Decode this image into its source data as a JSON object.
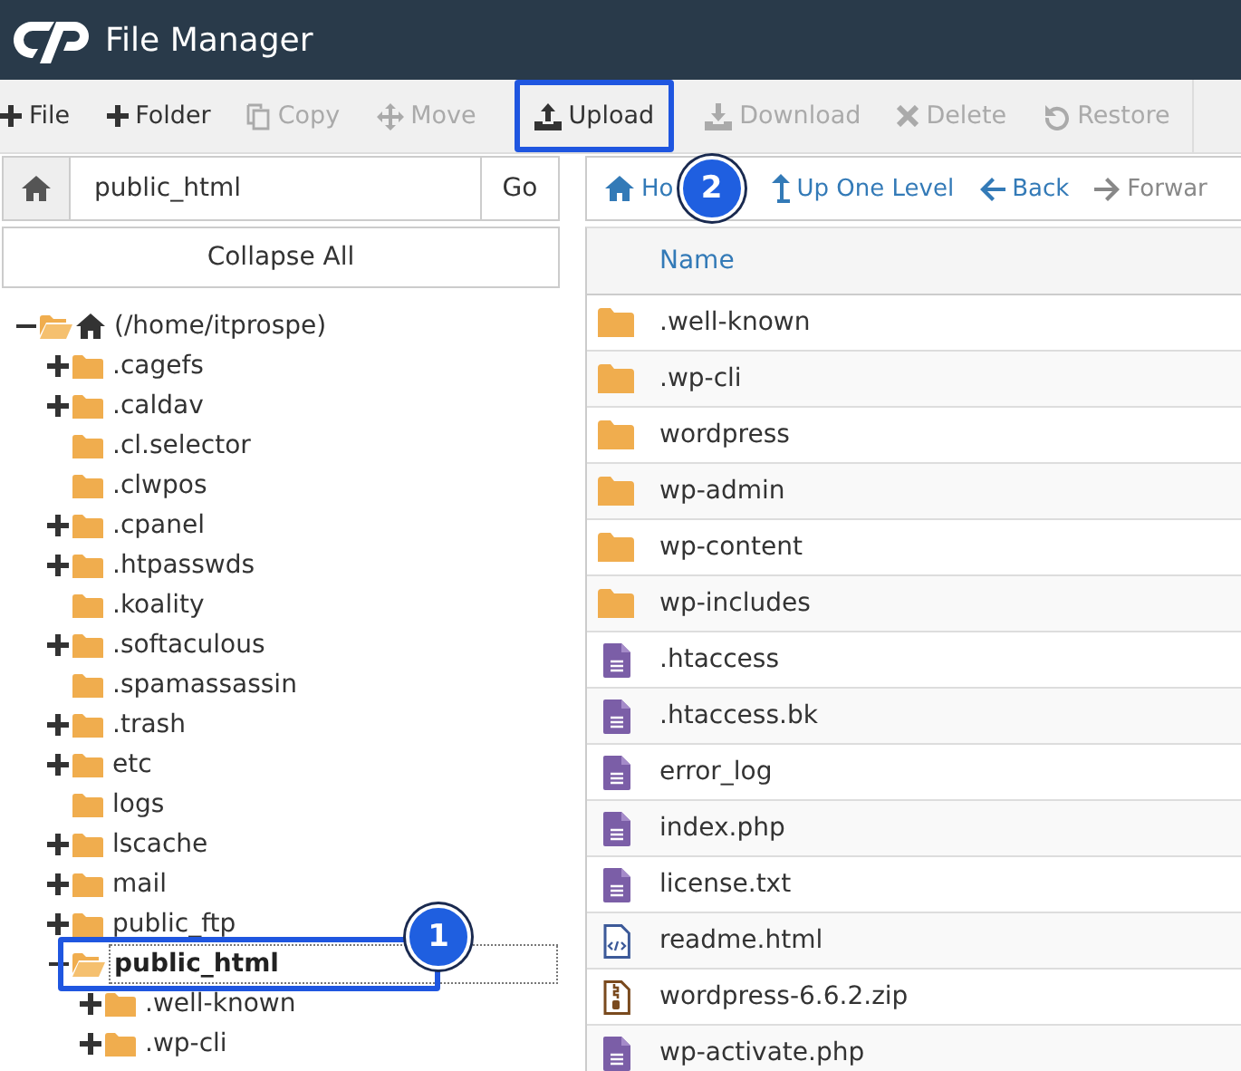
{
  "header": {
    "title": "File Manager"
  },
  "toolbar": [
    {
      "kind": "new-file",
      "label": "File",
      "disabled": false
    },
    {
      "kind": "new-folder",
      "label": "Folder",
      "disabled": false
    },
    {
      "kind": "copy",
      "label": "Copy",
      "disabled": true
    },
    {
      "kind": "move",
      "label": "Move",
      "disabled": true
    },
    {
      "kind": "upload",
      "label": "Upload",
      "disabled": false
    },
    {
      "kind": "download",
      "label": "Download",
      "disabled": true
    },
    {
      "kind": "delete",
      "label": "Delete",
      "disabled": true
    },
    {
      "kind": "restore",
      "label": "Restore",
      "disabled": true
    }
  ],
  "path_bar": {
    "value": "public_html",
    "go_label": "Go"
  },
  "collapse_label": "Collapse All",
  "tree": [
    {
      "kind": "home",
      "name": "(/home/itprospe)",
      "expandable": true,
      "expanded": true,
      "selected": false,
      "children": [
        {
          "name": ".cagefs",
          "expandable": true,
          "expanded": false,
          "selected": false
        },
        {
          "name": ".caldav",
          "expandable": true,
          "expanded": false,
          "selected": false
        },
        {
          "name": ".cl.selector",
          "expandable": false,
          "expanded": false,
          "selected": false
        },
        {
          "name": ".clwpos",
          "expandable": false,
          "expanded": false,
          "selected": false
        },
        {
          "name": ".cpanel",
          "expandable": true,
          "expanded": false,
          "selected": false
        },
        {
          "name": ".htpasswds",
          "expandable": true,
          "expanded": false,
          "selected": false
        },
        {
          "name": ".koality",
          "expandable": false,
          "expanded": false,
          "selected": false
        },
        {
          "name": ".softaculous",
          "expandable": true,
          "expanded": false,
          "selected": false
        },
        {
          "name": ".spamassassin",
          "expandable": false,
          "expanded": false,
          "selected": false
        },
        {
          "name": ".trash",
          "expandable": true,
          "expanded": false,
          "selected": false
        },
        {
          "name": "etc",
          "expandable": true,
          "expanded": false,
          "selected": false
        },
        {
          "name": "logs",
          "expandable": false,
          "expanded": false,
          "selected": false
        },
        {
          "name": "lscache",
          "expandable": true,
          "expanded": false,
          "selected": false
        },
        {
          "name": "mail",
          "expandable": true,
          "expanded": false,
          "selected": false
        },
        {
          "name": "public_ftp",
          "expandable": true,
          "expanded": false,
          "selected": false
        },
        {
          "name": "public_html",
          "expandable": true,
          "expanded": true,
          "selected": true,
          "children": [
            {
              "name": ".well-known",
              "expandable": true,
              "expanded": false,
              "selected": false
            },
            {
              "name": ".wp-cli",
              "expandable": true,
              "expanded": false,
              "selected": false
            }
          ]
        }
      ]
    }
  ],
  "nav": [
    {
      "kind": "home",
      "label": "Ho"
    },
    {
      "kind": "up",
      "label": "Up One Level"
    },
    {
      "kind": "back",
      "label": "Back"
    },
    {
      "kind": "forward",
      "label": "Forwar"
    }
  ],
  "table": {
    "columns": [
      "Name"
    ],
    "rows": [
      {
        "kind": "folder",
        "name": ".well-known"
      },
      {
        "kind": "folder",
        "name": ".wp-cli"
      },
      {
        "kind": "folder",
        "name": "wordpress"
      },
      {
        "kind": "folder",
        "name": "wp-admin"
      },
      {
        "kind": "folder",
        "name": "wp-content"
      },
      {
        "kind": "folder",
        "name": "wp-includes"
      },
      {
        "kind": "text",
        "name": ".htaccess"
      },
      {
        "kind": "text",
        "name": ".htaccess.bk"
      },
      {
        "kind": "text",
        "name": "error_log"
      },
      {
        "kind": "text",
        "name": "index.php"
      },
      {
        "kind": "text",
        "name": "license.txt"
      },
      {
        "kind": "html",
        "name": "readme.html"
      },
      {
        "kind": "archive",
        "name": "wordpress-6.6.2.zip"
      },
      {
        "kind": "text",
        "name": "wp-activate.php"
      }
    ]
  },
  "annotations": [
    {
      "label": "2"
    },
    {
      "label": "1"
    }
  ]
}
